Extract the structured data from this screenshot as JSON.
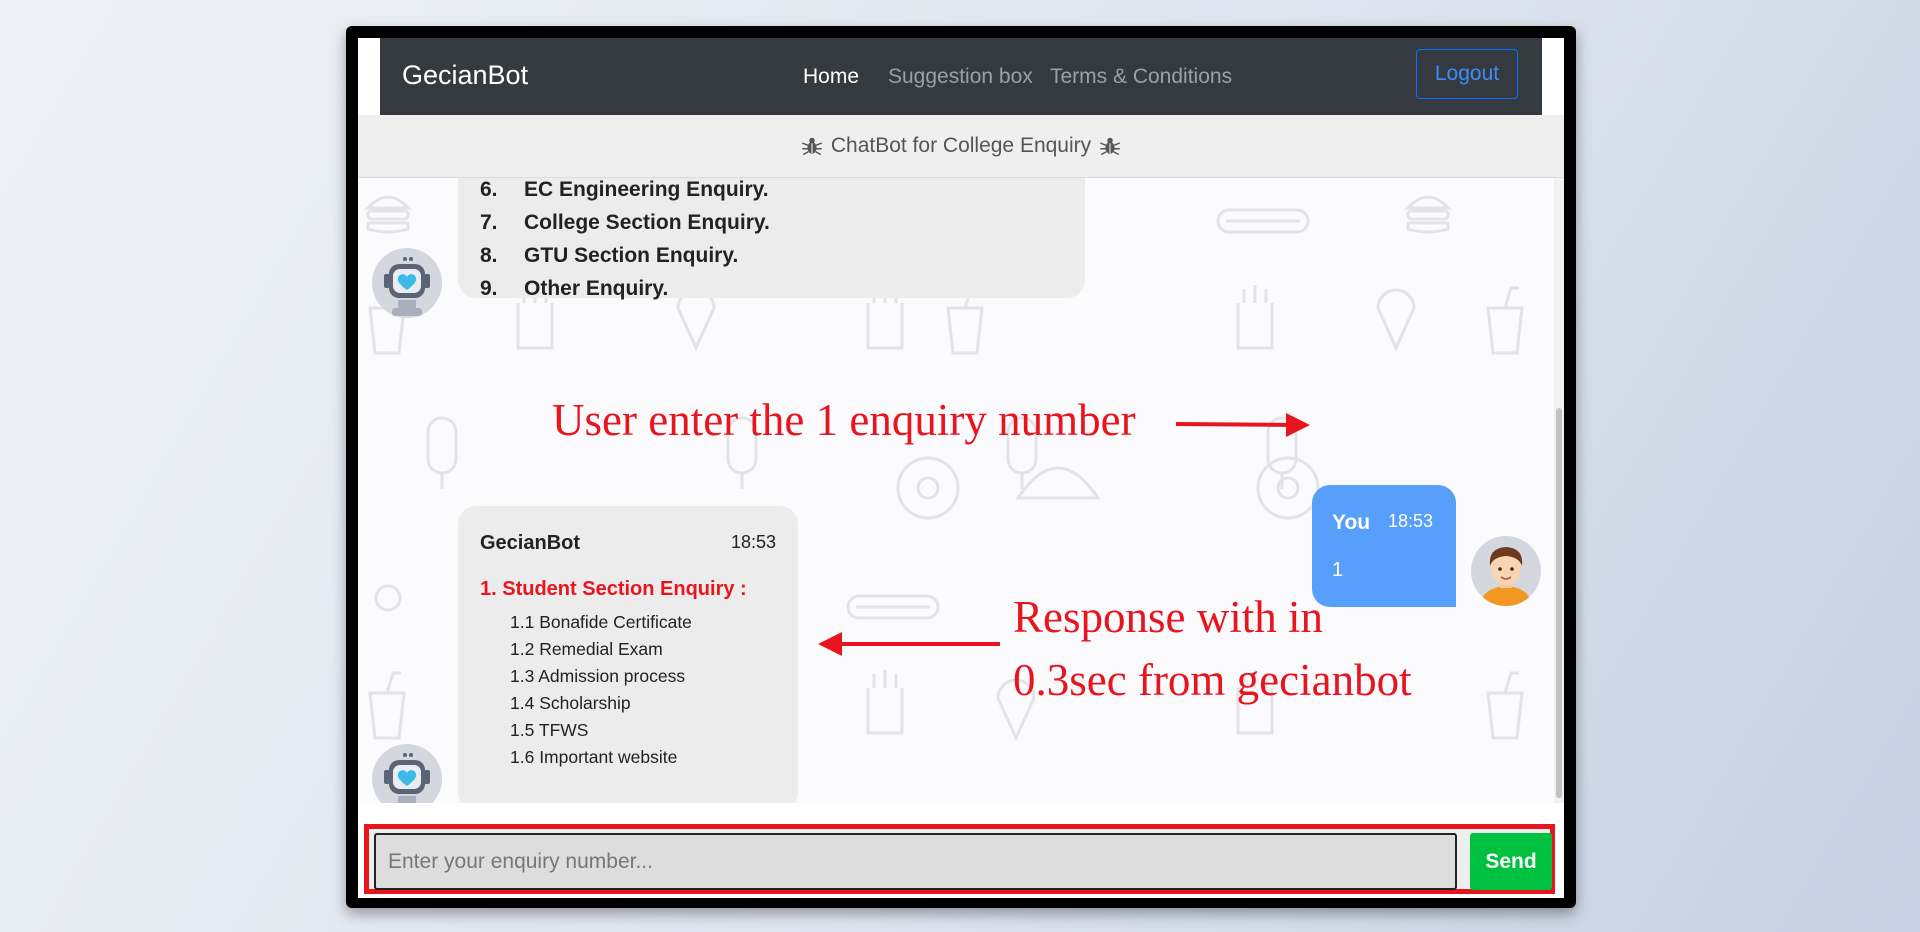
{
  "navbar": {
    "brand": "GecianBot",
    "links": [
      {
        "label": "Home",
        "active": true
      },
      {
        "label": "Suggestion box",
        "active": false
      },
      {
        "label": "Terms & Conditions",
        "active": false
      }
    ],
    "logout_label": "Logout"
  },
  "header": {
    "title": "ChatBot for College Enquiry",
    "icon": "bug-icon"
  },
  "messages": {
    "bot_menu": {
      "items": [
        {
          "num": "6.",
          "label": "EC Engineering Enquiry."
        },
        {
          "num": "7.",
          "label": "College Section Enquiry."
        },
        {
          "num": "8.",
          "label": "GTU Section Enquiry."
        },
        {
          "num": "9.",
          "label": "Other Enquiry."
        }
      ]
    },
    "user": {
      "name": "You",
      "time": "18:53",
      "text": "1"
    },
    "bot_reply": {
      "name": "GecianBot",
      "time": "18:53",
      "section": "1. Student Section Enquiry :",
      "items": [
        "1.1 Bonafide Certificate",
        "1.2 Remedial Exam",
        "1.3 Admission process",
        "1.4 Scholarship",
        "1.5 TFWS",
        "1.6 Important website"
      ]
    }
  },
  "annotations": {
    "user_note": "User enter the 1 enquiry number",
    "response_note_line1": "Response with in",
    "response_note_line2": "0.3sec from gecianbot",
    "color": "#e8141e"
  },
  "input": {
    "placeholder": "Enter your enquiry number...",
    "value": "",
    "send_label": "Send"
  },
  "colors": {
    "navbar": "#343a40",
    "user_bubble": "#579ffb",
    "bot_bubble": "#ececec",
    "send_button": "#00c040",
    "highlight": "#e8141e"
  }
}
